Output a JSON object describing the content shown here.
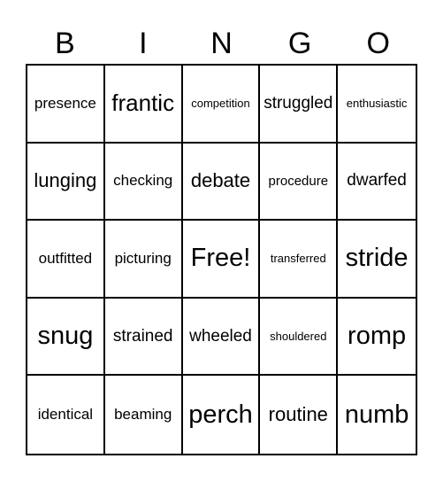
{
  "header": [
    "B",
    "I",
    "N",
    "G",
    "O"
  ],
  "cells": [
    [
      "presence",
      "frantic",
      "competition",
      "struggled",
      "enthusiastic"
    ],
    [
      "lunging",
      "checking",
      "debate",
      "procedure",
      "dwarfed"
    ],
    [
      "outfitted",
      "picturing",
      "Free!",
      "transferred",
      "stride"
    ],
    [
      "snug",
      "strained",
      "wheeled",
      "shouldered",
      "romp"
    ],
    [
      "identical",
      "beaming",
      "perch",
      "routine",
      "numb"
    ]
  ]
}
